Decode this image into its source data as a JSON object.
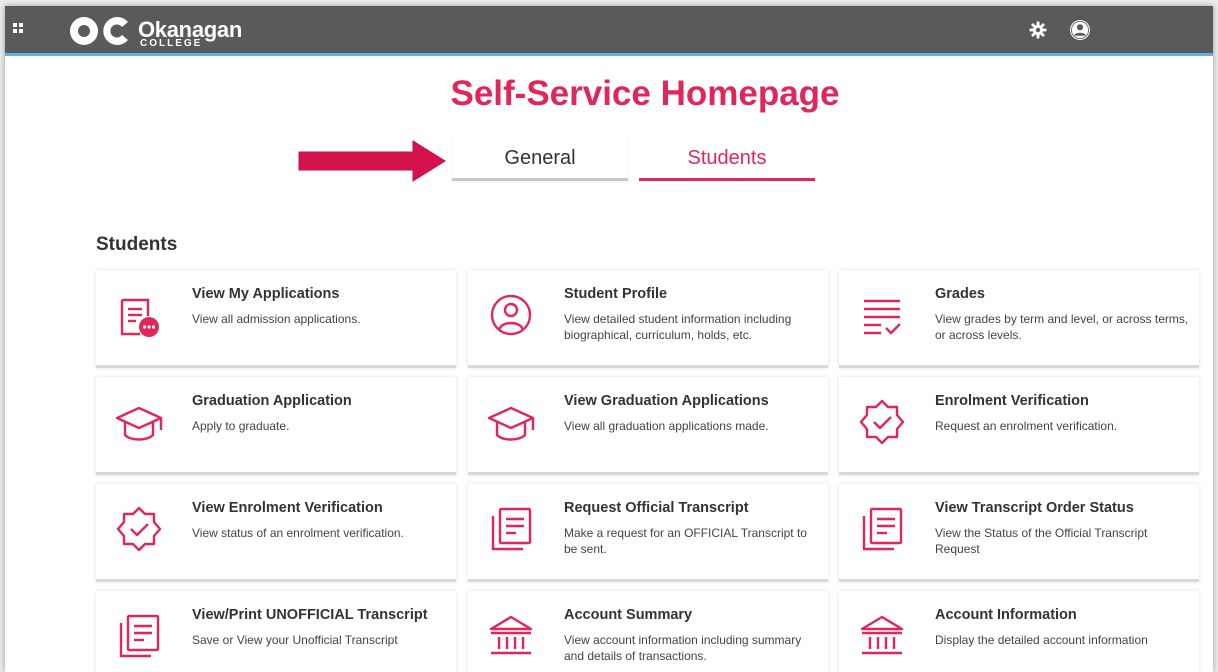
{
  "header": {
    "logo_text": "Okanagan",
    "logo_subtext": "COLLEGE",
    "logo_mark": "OC"
  },
  "page": {
    "title": "Self-Service Homepage"
  },
  "tabs": [
    {
      "label": "General"
    },
    {
      "label": "Students"
    }
  ],
  "section": {
    "heading": "Students"
  },
  "cards": [
    {
      "title": "View My Applications",
      "description": "View all admission applications.",
      "icon": "application-form-icon"
    },
    {
      "title": "Student Profile",
      "description": "View detailed student information including biographical, curriculum, holds, etc.",
      "icon": "user-profile-icon"
    },
    {
      "title": "Grades",
      "description": "View grades by term and level, or across terms, or across levels.",
      "icon": "grades-list-icon"
    },
    {
      "title": "Graduation Application",
      "description": "Apply to graduate.",
      "icon": "graduation-cap-icon"
    },
    {
      "title": "View Graduation Applications",
      "description": "View all graduation applications made.",
      "icon": "graduation-cap-icon"
    },
    {
      "title": "Enrolment Verification",
      "description": "Request an enrolment verification.",
      "icon": "verified-badge-icon"
    },
    {
      "title": "View Enrolment Verification",
      "description": "View status of an enrolment verification.",
      "icon": "verified-badge-icon"
    },
    {
      "title": "Request Official Transcript",
      "description": "Make a request for an OFFICIAL Transcript to be sent.",
      "icon": "transcript-document-icon"
    },
    {
      "title": "View Transcript Order Status",
      "description": "View the Status of the Official Transcript Request",
      "icon": "transcript-document-icon"
    },
    {
      "title": "View/Print UNOFFICIAL Transcript",
      "description": "Save or View your Unofficial Transcript",
      "icon": "transcript-document-icon"
    },
    {
      "title": "Account Summary",
      "description": "View account information including summary and details of transactions.",
      "icon": "bank-building-icon"
    },
    {
      "title": "Account Information",
      "description": "Display the detailed account information",
      "icon": "bank-building-icon"
    }
  ],
  "colors": {
    "accent": "#e0275a",
    "topbar": "#5a5a5a",
    "topbar_border": "#5fb0e6",
    "arrow": "#d4124e"
  }
}
